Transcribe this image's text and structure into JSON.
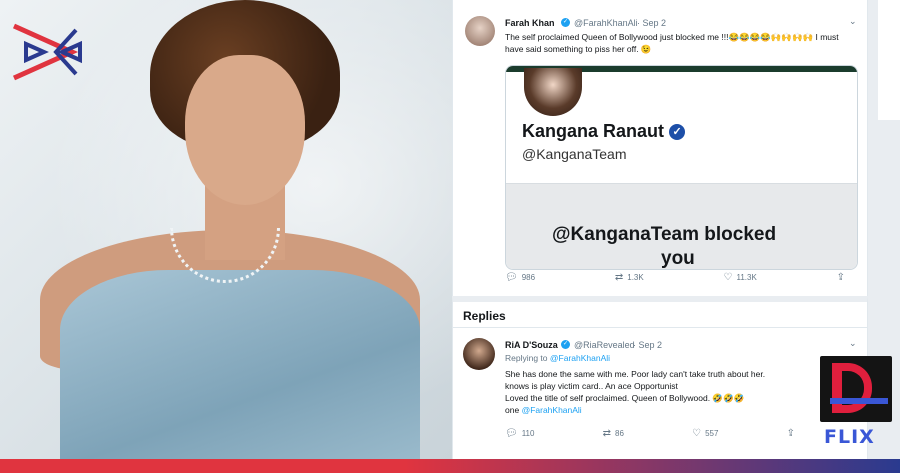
{
  "colors": {
    "verified": "#1da1f2",
    "link": "#1da1f2",
    "bottom_bar_left": "#e0343f",
    "bottom_bar_right": "#2a3a8f",
    "brand_red": "#e01f3d",
    "brand_blue": "#3a57d6"
  },
  "tweet": {
    "name": "Farah Khan",
    "handle": "@FarahKhanAli",
    "date": "· Sep 2",
    "text": "The self proclaimed Queen of Bollywood just blocked me !!!😂😂😂😂🙌🙌🙌🙌 I must have said something to piss her off. 😉",
    "embed": {
      "name": "Kangana Ranaut",
      "handle": "@KanganaTeam",
      "blocked_line1": "@KanganaTeam blocked",
      "blocked_line2": "you"
    },
    "reply_count": "986",
    "retweet_count": "1.3K",
    "like_count": "11.3K"
  },
  "replies_header": "Replies",
  "reply": {
    "name": "RiA D'Souza",
    "handle": "@RiaRevealed",
    "date": "· Sep 2",
    "replying_to_prefix": "Replying to",
    "replying_to_handle": "@FarahKhanAli",
    "line1": "She has done the same with me. Poor lady can't take truth about her.",
    "line2": "knows is play victim card.. An ace Opportunist",
    "line3": "Loved the title of self proclaimed. Queen of Bollywood. 🤣🤣🤣",
    "line4_prefix": "one",
    "line4_handle": "@FarahKhanAli",
    "reply_count": "110",
    "retweet_count": "86",
    "like_count": "557"
  },
  "brand_badge_text": "FLIX"
}
